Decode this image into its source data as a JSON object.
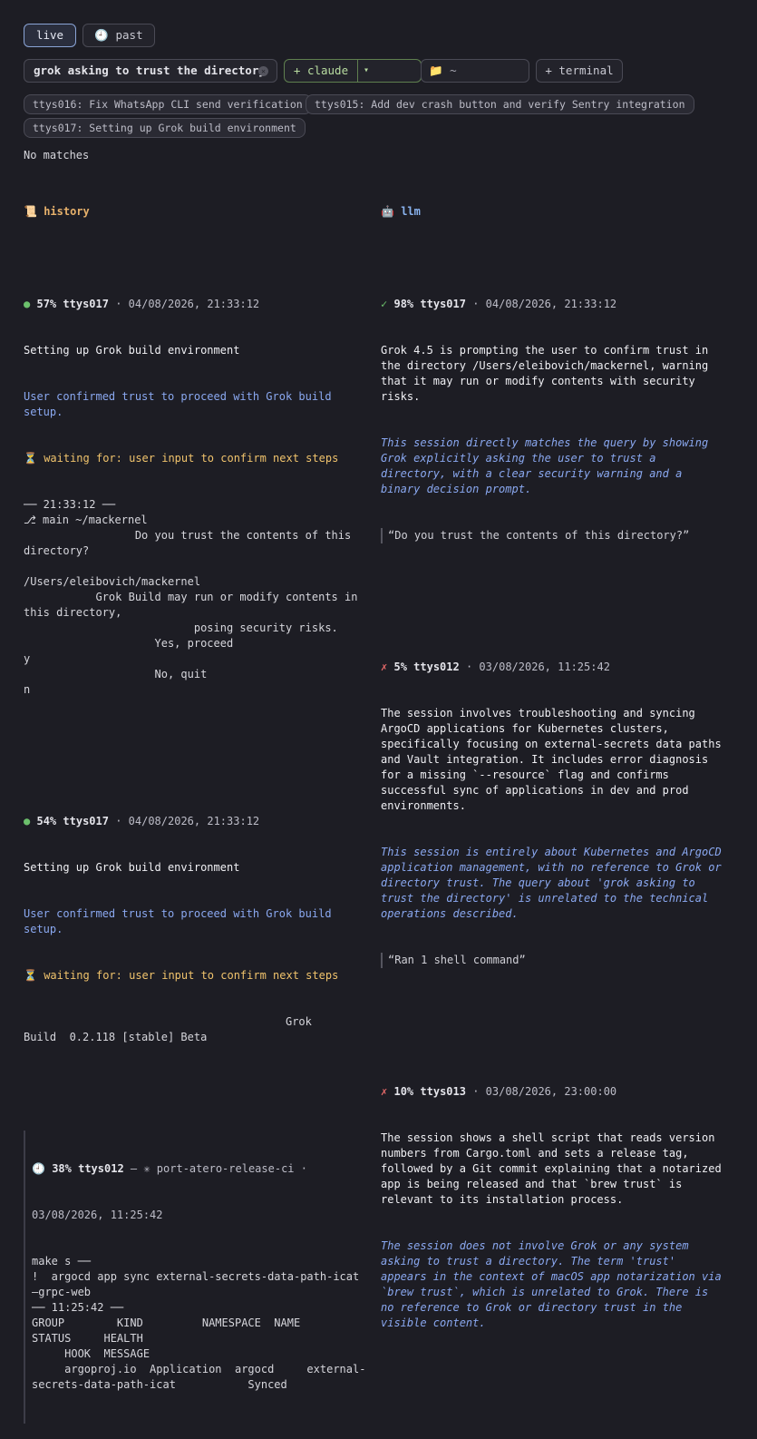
{
  "tabs": {
    "live": "live",
    "past": "past",
    "past_icon": "clock-icon"
  },
  "toolbar": {
    "search_value": "grok asking to trust the directory",
    "claude_label": "+ claude",
    "model_caret": "▾",
    "dir_value": "~",
    "terminal_label": "+ terminal"
  },
  "chips": [
    "ttys016: Fix WhatsApp CLI send verification",
    "ttys015: Add dev crash button and verify Sentry integration",
    "ttys017: Setting up Grok build environment"
  ],
  "no_matches": "No matches",
  "history": {
    "header": "history",
    "results": [
      {
        "pct": "57%",
        "tty": "ttys017",
        "time": "04/08/2026, 21:33:12",
        "title": "Setting up Grok build environment",
        "summary": "User confirmed trust to proceed with Grok build setup.",
        "waiting": "waiting for: user input to confirm next steps",
        "lines": [
          "── 21:33:12 ──",
          "⎇ main ~/mackernel",
          "                 Do you trust the contents of this",
          "directory?",
          "",
          "/Users/eleibovich/mackernel",
          "           Grok Build may run or modify contents in",
          "this directory,",
          "                          posing security risks.",
          "                    Yes, proceed",
          "y",
          "                    No, quit",
          "n"
        ]
      },
      {
        "pct": "54%",
        "tty": "ttys017",
        "time": "04/08/2026, 21:33:12",
        "title": "Setting up Grok build environment",
        "summary": "User confirmed trust to proceed with Grok build setup.",
        "waiting": "waiting for: user input to confirm next steps",
        "lines": [
          "                                        Grok",
          "Build  0.2.118 [stable] Beta"
        ]
      }
    ],
    "nested": {
      "pct": "38%",
      "tty": "ttys012",
      "rest": " — ✳ port-atero-release-ci ·",
      "time": "03/08/2026, 11:25:42",
      "lines": [
        "make s ──",
        "!  argocd app sync external-secrets-data-path-icat",
        "—grpc-web",
        "── 11:25:42 ──",
        "GROUP        KIND         NAMESPACE  NAME",
        "STATUS     HEALTH",
        "     HOOK  MESSAGE",
        "     argoproj.io  Application  argocd     external-",
        "secrets-data-path-icat           Synced"
      ]
    }
  },
  "llm": {
    "header": "llm",
    "results": [
      {
        "mark": "✓",
        "pct": "98%",
        "tty": "ttys017",
        "time": "04/08/2026, 21:33:12",
        "body": "Grok 4.5 is prompting the user to confirm trust in\nthe directory /Users/eleibovich/mackernel, warning\nthat it may run or modify contents with security\nrisks.",
        "reason": "This session directly matches the query by showing\nGrok explicitly asking the user to trust a\ndirectory, with a clear security warning and a\nbinary decision prompt.",
        "quote": "“Do you trust the contents of this directory?”"
      },
      {
        "mark": "✗",
        "pct": "5%",
        "tty": "ttys012",
        "time": "03/08/2026, 11:25:42",
        "body": "The session involves troubleshooting and syncing\nArgoCD applications for Kubernetes clusters,\nspecifically focusing on external-secrets data paths\nand Vault integration. It includes error diagnosis\nfor a missing `--resource` flag and confirms\nsuccessful sync of applications in dev and prod\nenvironments.",
        "reason": "This session is entirely about Kubernetes and ArgoCD\napplication management, with no reference to Grok or\ndirectory trust. The query about 'grok asking to\ntrust the directory' is unrelated to the technical\noperations described.",
        "quote": "“Ran 1 shell command”"
      },
      {
        "mark": "✗",
        "pct": "10%",
        "tty": "ttys013",
        "time": "03/08/2026, 23:00:00",
        "body": "The session shows a shell script that reads version\nnumbers from Cargo.toml and sets a release tag,\nfollowed by a Git commit explaining that a notarized\napp is being released and that `brew trust` is\nrelevant to its installation process.",
        "reason": "The session does not involve Grok or any system\nasking to trust a directory. The term 'trust'\nappears in the context of macOS app notarization via\n`brew trust`, which is unrelated to Grok. There is\nno reference to Grok or directory trust in the\nvisible content."
      }
    ]
  },
  "colors": {
    "bg": "#1d1d24",
    "accent": "#8aa8f0",
    "warn": "#f0c36c",
    "ok": "#6cc06c",
    "bad": "#e86a6a",
    "history": "#e7b16b"
  }
}
